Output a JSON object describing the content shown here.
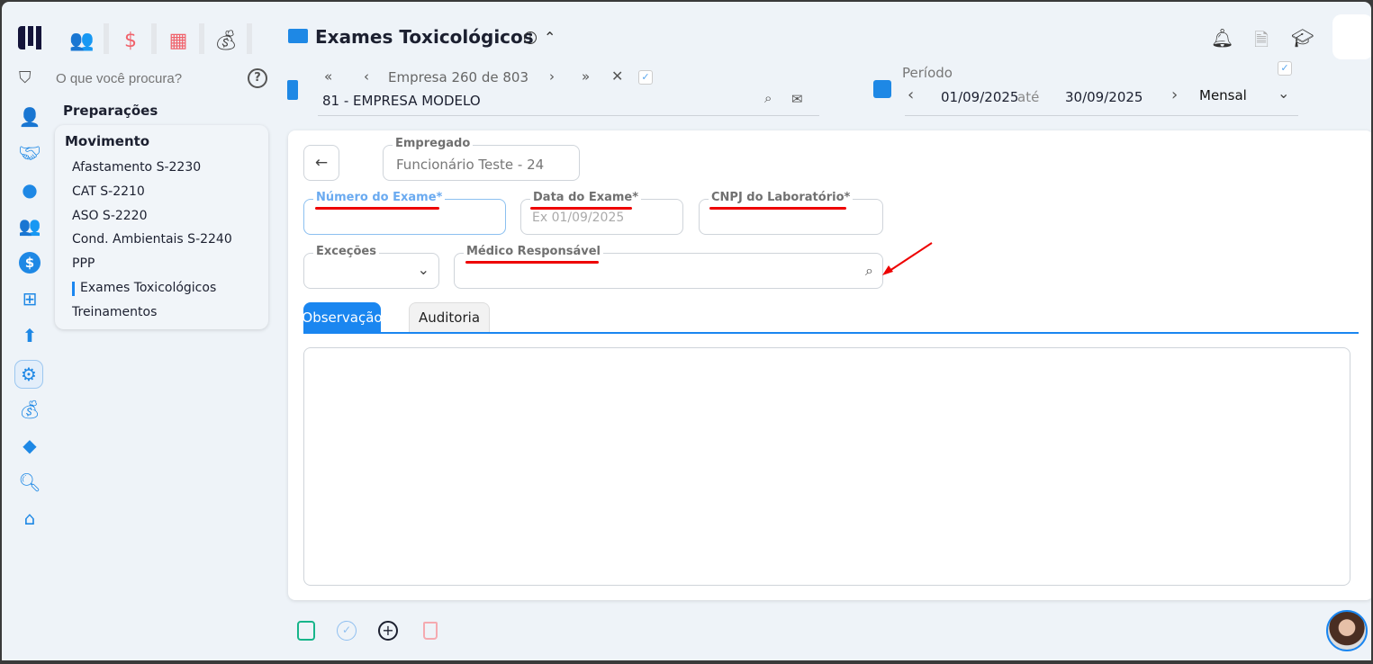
{
  "top_modules": [
    {
      "icon": "users-icon"
    },
    {
      "icon": "dollar-icon"
    },
    {
      "icon": "calculator-icon"
    },
    {
      "icon": "money-bag-icon"
    }
  ],
  "search": {
    "placeholder": "O que você procura?"
  },
  "menu": {
    "section": "Preparações",
    "group": "Movimento",
    "items": [
      "Afastamento S-2230",
      "CAT S-2210",
      "ASO S-2220",
      "Cond. Ambientais S-2240",
      "PPP",
      "Exames Toxicológicos",
      "Treinamentos"
    ],
    "active": "Exames Toxicológicos"
  },
  "header": {
    "title": "Exames Toxicológicos"
  },
  "company": {
    "nav_text": "Empresa 260 de 803",
    "name": "81 - EMPRESA MODELO"
  },
  "period": {
    "label": "Período",
    "start": "01/09/2025",
    "separator": "até",
    "end": "30/09/2025",
    "mode": "Mensal"
  },
  "form": {
    "employee_label": "Empregado",
    "employee_value": "Funcionário Teste - 24",
    "exam_number_label": "Número do Exame*",
    "exam_number_value": "",
    "exam_date_label": "Data do Exame*",
    "exam_date_placeholder": "Ex 01/09/2025",
    "lab_cnpj_label": "CNPJ do Laboratório*",
    "lab_cnpj_value": "",
    "exceptions_label": "Exceções",
    "doctor_label": "Médico Responsável"
  },
  "tabs": [
    "Observação",
    "Auditoria"
  ],
  "colors": {
    "accent": "#1a86f0",
    "danger": "#e00000",
    "save": "#17b58a"
  }
}
